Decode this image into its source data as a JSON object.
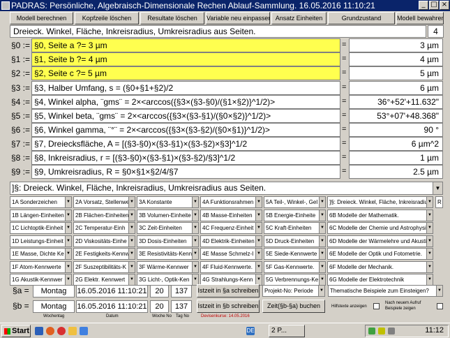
{
  "window": {
    "title": "PADRAS: Persönliche, Algebraisch-Dimensionale Rechen Ablauf-Sammlung. 16.05.2016    11:10:21"
  },
  "toolbar": {
    "buttons": [
      "Modell berechnen",
      "Kopfzeile löschen",
      "Resultate löschen",
      "Variable neu einpassen",
      "Ansatz Einheiten",
      "Grundzustand",
      "Modell bewahren"
    ]
  },
  "header": {
    "title": "Dreieck. Winkel, Fläche, Inkreisradius, Umkreisradius aus Seiten.",
    "number": "4"
  },
  "variables": [
    {
      "label": "§0 :=",
      "expr": "§0, Seite a ?= 3 µm",
      "eq": "=",
      "value": "3 µm",
      "highlight": true
    },
    {
      "label": "§1 :=",
      "expr": "§1, Seite b ?= 4 µm",
      "eq": "=",
      "value": "4 µm",
      "highlight": true
    },
    {
      "label": "§2 :=",
      "expr": "§2, Seite c ?= 5 µm",
      "eq": "=",
      "value": "5 µm",
      "highlight": true
    },
    {
      "label": "§3 :=",
      "expr": "§3, Halber Umfang, s = (§0+§1+§2)/2",
      "eq": "=",
      "value": "6 µm",
      "highlight": false
    },
    {
      "label": "§4 :=",
      "expr": "§4, Winkel alpha, ¨gms¨ = 2×<arccos({§3×(§3-§0)/(§1×§2)}^1/2)>",
      "eq": "=",
      "value": "36°+52'+11.632\"",
      "highlight": false
    },
    {
      "label": "§5 :=",
      "expr": "§5, Winkel beta, ¨gms¨ = 2×<arccos({§3×(§3-§1)/(§0×§2)}^1/2)>",
      "eq": "=",
      "value": "53°+07'+48.368\"",
      "highlight": false
    },
    {
      "label": "§6 :=",
      "expr": "§6, Winkel gamma, ¨°¨ = 2×<arccos({§3×(§3-§2)/(§0×§1)}^1/2)>",
      "eq": "=",
      "value": "90 °",
      "highlight": false
    },
    {
      "label": "§7 :=",
      "expr": "§7, Dreiecksfläche, A = [(§3-§0)×(§3-§1)×(§3-§2)×§3]^1/2",
      "eq": "=",
      "value": "6 µm^2",
      "highlight": false
    },
    {
      "label": "§8 :=",
      "expr": "§8, Inkreisradius, r = [(§3-§0)×(§3-§1)×(§3-§2)/§3]^1/2",
      "eq": "=",
      "value": "1 µm",
      "highlight": false
    },
    {
      "label": "§9 :=",
      "expr": "§9, Umkreisradius, R = §0×§1×§2/4/§7",
      "eq": "=",
      "value": "2.5 µm",
      "highlight": false
    }
  ],
  "formula_line": "]§: Dreieck. Winkel, Fläche, Inkreisradius, Umkreisradius aus Seiten.",
  "unit_grid": [
    [
      "1A Sonderzeichen",
      "2A Vorsatz, Stellenwe",
      "3A Konstante",
      "4A Funktionsrahmen",
      "5A Teil-, Winkel-, Gel",
      "]§: Dreieck. Winkel, Fläche, Inkreisradius"
    ],
    [
      "1B Längen-Einheiten",
      "2B Flächen-Einheiten",
      "3B Volumen-Einheite",
      "4B Masse-Einheiten",
      "5B Energie-Einheite",
      "6B  Modelle der Mathematik."
    ],
    [
      "1C Lichtoptik-Einheit",
      "2C Temperatur-Einh",
      "3C Zeit-Einheiten",
      "4C Frequenz-Einheit",
      "5C Kraft-Einheiten",
      "6C  Modelle der Chemie und Astrophysik."
    ],
    [
      "1D Leistungs-Einheit",
      "2D Viskositäts-Einhe",
      "3D Dosis-Einheiten",
      "4D Elektrik-Einheiten",
      "5D Druck-Einheiten",
      "6D  Modelle der Wärmelehre und Akustik."
    ],
    [
      "1E  Masse, Dichte Ke",
      "2E  Festigkeits-Kennw",
      "3E  Resistivitäts-Kenn",
      "4E  Masse Schmelz-I",
      "5E  Siede-Kennwerte",
      "6E  Modelle der Optik und Fotometrie."
    ],
    [
      "1F  Atom-Kennwerte",
      "2F  Suszeptibilitäts-K",
      "3F  Wärme-Kennwer",
      "4F  Fluid-Kennwerte.",
      "5F  Gas-Kennwerte.",
      "6F  Modelle der Mechanik."
    ],
    [
      "1G  Akustik-Kennwer",
      "2G  Elektr. Kennwert",
      "3G  Licht-, Optik-Ken",
      "4G  Strahlungs-Kenn",
      "5G  Verbrennungs-Ke",
      "6G  Modelle der Elektrotechnik"
    ]
  ],
  "extra_small": "R",
  "bottom": {
    "a_label": "§a =",
    "b_label": "§b =",
    "a_day": "Montag",
    "a_datetime": "16.05.2016 11:10:21",
    "a_week": "20",
    "a_daynum": "137",
    "b_day": "Montag",
    "b_datetime": "16.05.2016 11:10:21",
    "b_week": "20",
    "b_daynum": "137",
    "btn_write_a": "Istzeit in §a schreiben",
    "btn_write_b": "Istzeit in §b schreiben",
    "btn_zeit": "Zeit(§b-§a) buchen",
    "combo_projekt": "Projekt-No: Periode",
    "combo_thematische": "Thematische Beispiele zum Einsteigen?",
    "cap_wochentag": "Wochentag",
    "cap_datum": "Datum",
    "cap_woche": "Woche No",
    "cap_tag": "Tag No",
    "cap_devisen": "Devisenkurse: 14.05.2016",
    "cap_hilfstexte": "Hilfstexte anzeigen",
    "cap_nach_aufruf": "Nach neuem Aufruf\nBeispiele zeigen"
  },
  "taskbar": {
    "start": "Start",
    "item": "2 P...",
    "lang": "DE",
    "time": "11:12"
  }
}
